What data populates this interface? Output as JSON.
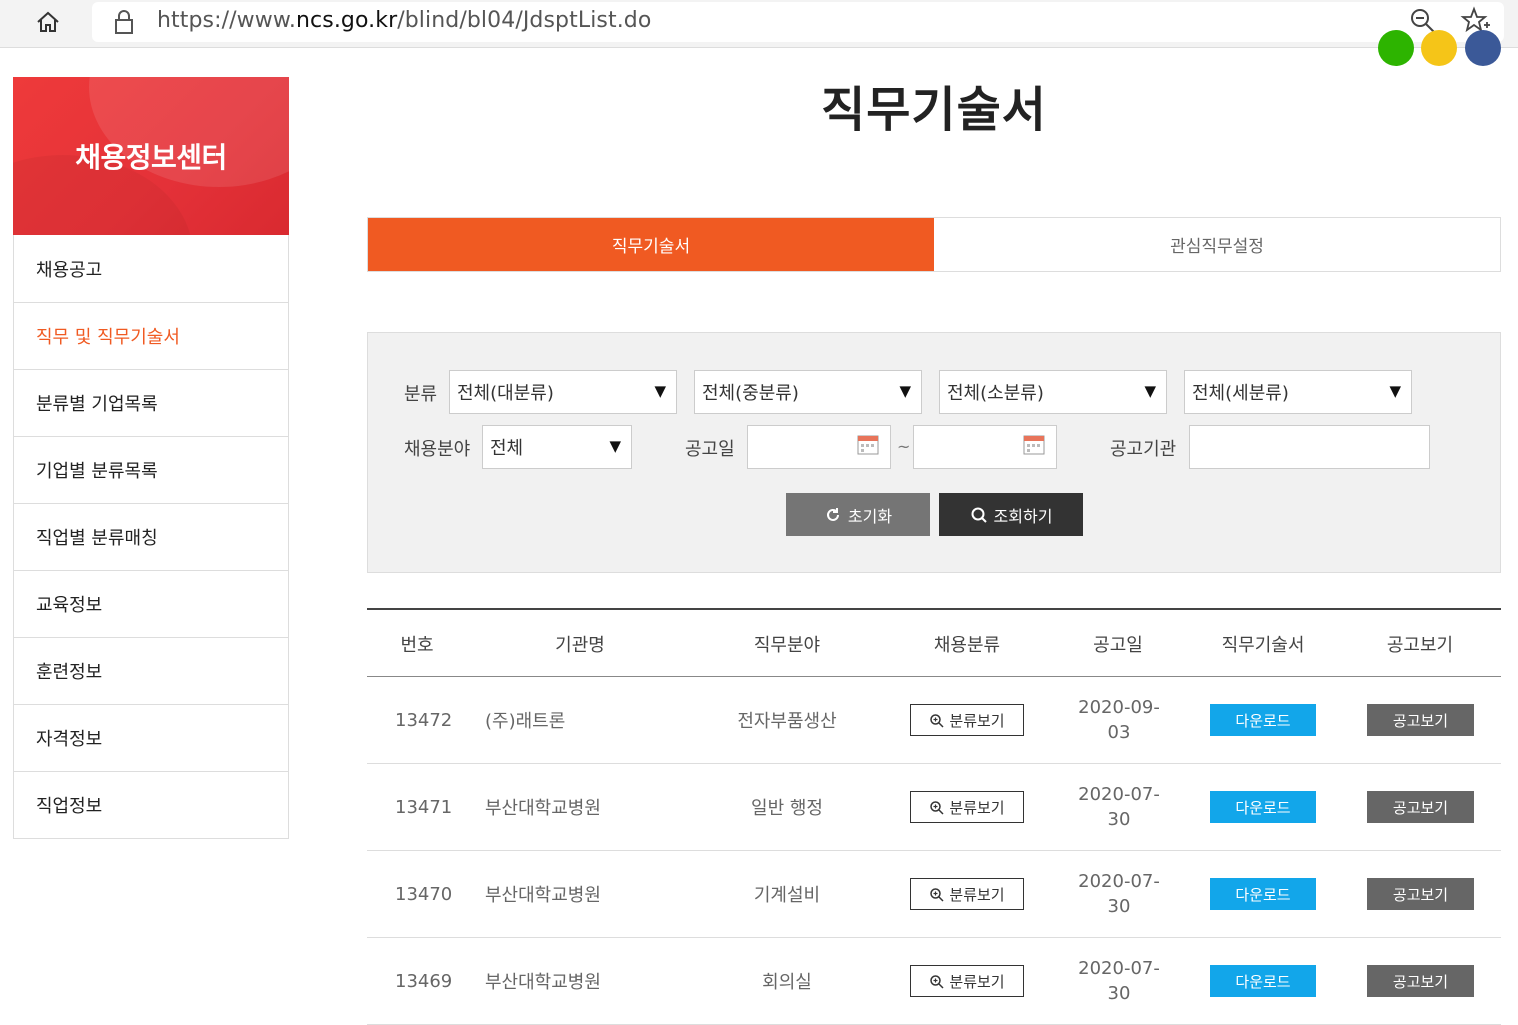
{
  "browser": {
    "url_prefix": "https://www.",
    "url_domain": "ncs.go.kr",
    "url_path": "/blind/bl04/JdsptList.do"
  },
  "sidebar": {
    "title": "채용정보센터",
    "items": [
      {
        "label": "채용공고"
      },
      {
        "label": "직무 및 직무기술서"
      },
      {
        "label": "분류별 기업목록"
      },
      {
        "label": "기업별 분류목록"
      },
      {
        "label": "직업별 분류매칭"
      },
      {
        "label": "교육정보"
      },
      {
        "label": "훈련정보"
      },
      {
        "label": "자격정보"
      },
      {
        "label": "직업정보"
      }
    ]
  },
  "page": {
    "title": "직무기술서"
  },
  "tabs": [
    {
      "label": "직무기술서"
    },
    {
      "label": "관심직무설정"
    }
  ],
  "filters": {
    "category_label": "분류",
    "category_selects": [
      {
        "value": "전체(대분류)"
      },
      {
        "value": "전체(중분류)"
      },
      {
        "value": "전체(소분류)"
      },
      {
        "value": "전체(세분류)"
      }
    ],
    "field_label": "채용분야",
    "field_value": "전체",
    "date_label": "공고일",
    "date_separator": "~",
    "agency_label": "공고기관",
    "reset_label": "초기화",
    "search_label": "조회하기"
  },
  "table": {
    "headers": [
      "번호",
      "기관명",
      "직무분야",
      "채용분류",
      "공고일",
      "직무기술서",
      "공고보기"
    ],
    "class_button": "분류보기",
    "download_button": "다운로드",
    "view_button": "공고보기",
    "rows": [
      {
        "no": "13472",
        "agency": "(주)래트론",
        "field": "전자부품생산",
        "date_top": "2020-09-",
        "date_bottom": "03"
      },
      {
        "no": "13471",
        "agency": "부산대학교병원",
        "field": "일반 행정",
        "date_top": "2020-07-",
        "date_bottom": "30"
      },
      {
        "no": "13470",
        "agency": "부산대학교병원",
        "field": "기계설비",
        "date_top": "2020-07-",
        "date_bottom": "30"
      },
      {
        "no": "13469",
        "agency": "부산대학교병원",
        "field": "회의실",
        "date_top": "2020-07-",
        "date_bottom": "30"
      }
    ]
  }
}
